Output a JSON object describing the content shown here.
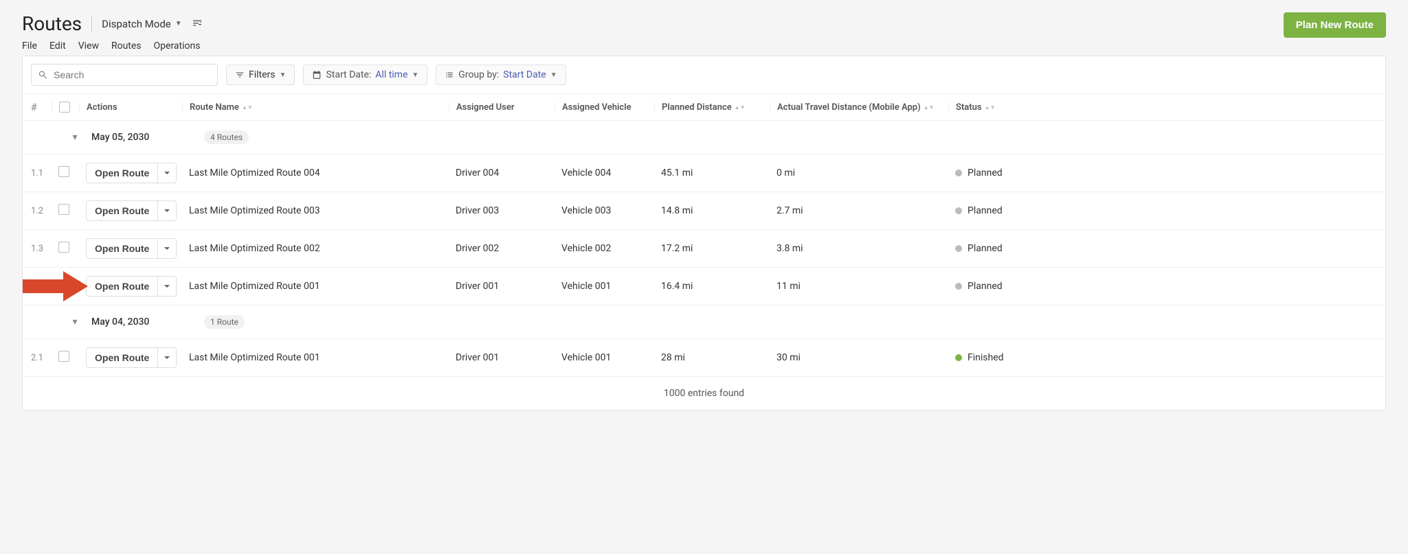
{
  "header": {
    "title": "Routes",
    "dispatch_mode_label": "Dispatch Mode",
    "menu": [
      "File",
      "Edit",
      "View",
      "Routes",
      "Operations"
    ],
    "plan_button": "Plan New Route"
  },
  "toolbar": {
    "search_placeholder": "Search",
    "filters_label": "Filters",
    "start_date_label": "Start Date:",
    "start_date_value": "All time",
    "group_by_label": "Group by:",
    "group_by_value": "Start Date"
  },
  "columns": {
    "actions": "Actions",
    "route_name": "Route Name",
    "assigned_user": "Assigned User",
    "assigned_vehicle": "Assigned Vehicle",
    "planned_distance": "Planned Distance",
    "actual_distance": "Actual Travel Distance (Mobile App)",
    "status": "Status"
  },
  "groups": [
    {
      "date": "May 05, 2030",
      "badge": "4 Routes",
      "rows": [
        {
          "idx": "1.1",
          "open": "Open Route",
          "name": "Last Mile Optimized Route 004",
          "user": "Driver 004",
          "vehicle": "Vehicle 004",
          "planned": "45.1 mi",
          "actual": "0 mi",
          "status": "Planned",
          "dot": "gray",
          "arrow": false
        },
        {
          "idx": "1.2",
          "open": "Open Route",
          "name": "Last Mile Optimized Route 003",
          "user": "Driver 003",
          "vehicle": "Vehicle 003",
          "planned": "14.8 mi",
          "actual": "2.7 mi",
          "status": "Planned",
          "dot": "gray",
          "arrow": false
        },
        {
          "idx": "1.3",
          "open": "Open Route",
          "name": "Last Mile Optimized Route 002",
          "user": "Driver 002",
          "vehicle": "Vehicle 002",
          "planned": "17.2 mi",
          "actual": "3.8 mi",
          "status": "Planned",
          "dot": "gray",
          "arrow": false
        },
        {
          "idx": "",
          "open": "Open Route",
          "name": "Last Mile Optimized Route 001",
          "user": "Driver 001",
          "vehicle": "Vehicle 001",
          "planned": "16.4 mi",
          "actual": "11 mi",
          "status": "Planned",
          "dot": "gray",
          "arrow": true
        }
      ]
    },
    {
      "date": "May 04, 2030",
      "badge": "1 Route",
      "rows": [
        {
          "idx": "2.1",
          "open": "Open Route",
          "name": "Last Mile Optimized Route 001",
          "user": "Driver 001",
          "vehicle": "Vehicle 001",
          "planned": "28 mi",
          "actual": "30 mi",
          "status": "Finished",
          "dot": "green",
          "arrow": false
        }
      ]
    }
  ],
  "footer": {
    "text": "1000 entries found"
  }
}
